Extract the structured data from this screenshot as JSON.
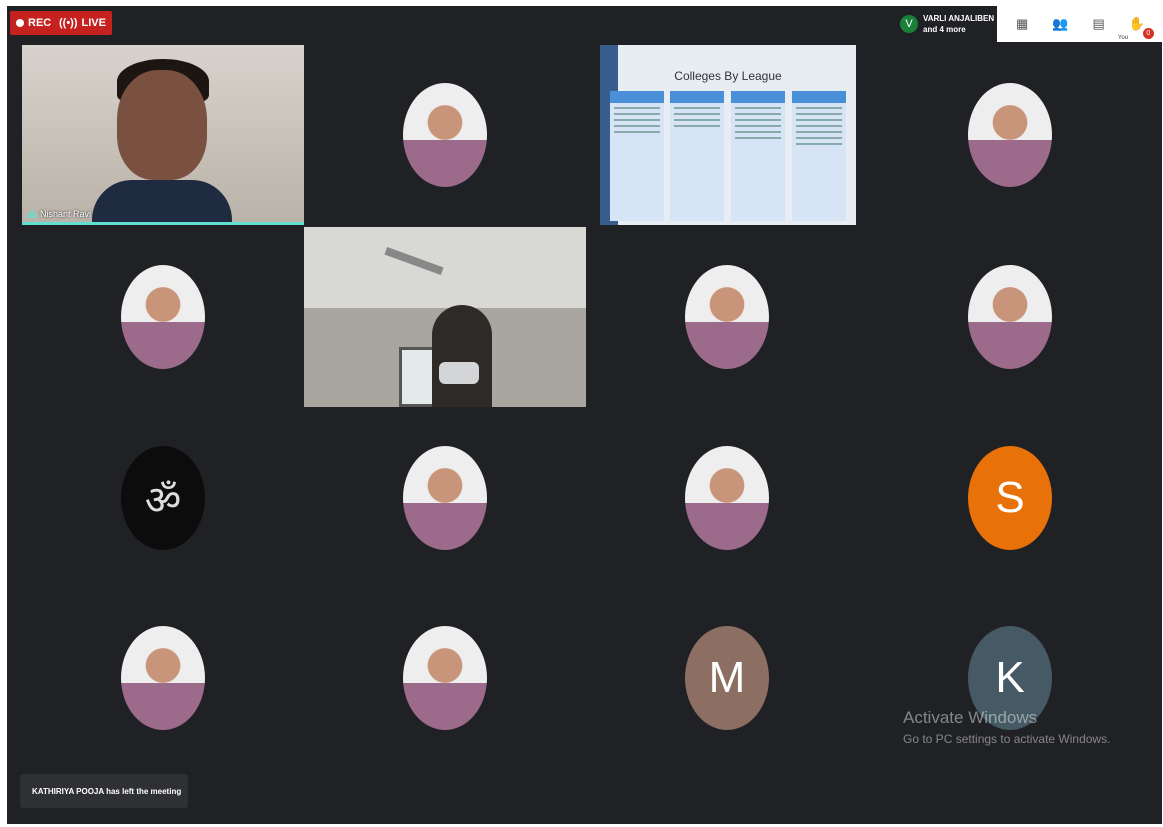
{
  "topbar": {
    "rec_label": "REC",
    "live_label": "LIVE",
    "notification": {
      "avatar_letter": "V",
      "line1": "VARLI ANJALIBEN",
      "line2": "and 4 more"
    },
    "tools": [
      {
        "icon": "qr-code-icon"
      },
      {
        "icon": "participants-icon"
      },
      {
        "icon": "chat-icon"
      },
      {
        "icon": "raise-hand-icon",
        "label": "You",
        "count": "0"
      }
    ]
  },
  "tiles": [
    {
      "kind": "video",
      "name": "Nishant Ravi"
    },
    {
      "kind": "avatar-photo"
    },
    {
      "kind": "shared-slide",
      "slide_title": "Colleges By League"
    },
    {
      "kind": "avatar-photo"
    },
    {
      "kind": "avatar-photo"
    },
    {
      "kind": "video"
    },
    {
      "kind": "avatar-photo"
    },
    {
      "kind": "avatar-photo"
    },
    {
      "kind": "avatar-symbol",
      "symbol": "ॐ"
    },
    {
      "kind": "avatar-photo"
    },
    {
      "kind": "avatar-photo"
    },
    {
      "kind": "avatar-letter",
      "letter": "S",
      "color": "#e8710a"
    },
    {
      "kind": "avatar-photo"
    },
    {
      "kind": "avatar-photo"
    },
    {
      "kind": "avatar-letter",
      "letter": "M",
      "color": "#8d6e63"
    },
    {
      "kind": "avatar-letter",
      "letter": "K",
      "color": "#455a64"
    }
  ],
  "toast": "KATHIRIYA POOJA has left the meeting",
  "watermark": {
    "title": "Activate Windows",
    "subtitle": "Go to PC settings to activate Windows."
  }
}
